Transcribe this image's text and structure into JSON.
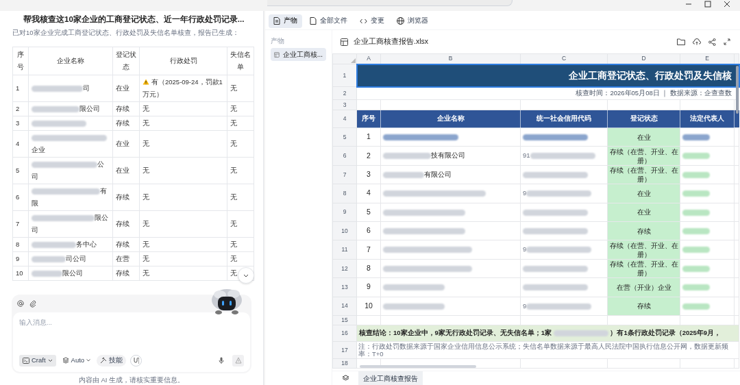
{
  "chat": {
    "title": "帮我核查这10家企业的工商登记状态、近一年行政处罚记录...",
    "intro": "已对10家企业完成工商登记状态、行政处罚及失信名单核查，报告已生成：",
    "table": {
      "columns": [
        "序号",
        "企业名称",
        "登记状态",
        "行政处罚",
        "失信名单"
      ],
      "rows": [
        {
          "index": "1",
          "name_blurred": true,
          "name": "司",
          "status": "在业",
          "warning": true,
          "penalty": "有（2025-09-24，罚款1万元）",
          "dishonest": "无"
        },
        {
          "index": "2",
          "name_blurred": true,
          "name": "限公司",
          "status": "存续",
          "warning": false,
          "penalty": "无",
          "dishonest": "无"
        },
        {
          "index": "3",
          "name_blurred": true,
          "status": "存续",
          "warning": false,
          "penalty": "无",
          "dishonest": "无"
        },
        {
          "index": "4",
          "name_blurred": true,
          "name": "企业",
          "status": "在业",
          "warning": false,
          "penalty": "无",
          "dishonest": "无"
        },
        {
          "index": "5",
          "name_blurred": true,
          "name": "公司",
          "status": "在业",
          "warning": false,
          "penalty": "无",
          "dishonest": "无"
        },
        {
          "index": "6",
          "name_blurred": true,
          "name": "有限",
          "status": "存续",
          "warning": false,
          "penalty": "无",
          "dishonest": "无"
        },
        {
          "index": "7",
          "name_blurred": true,
          "name": "限公司",
          "status": "存续",
          "warning": false,
          "penalty": "无",
          "dishonest": "无"
        },
        {
          "index": "8",
          "name_blurred": true,
          "name": "务中心",
          "status": "存续",
          "warning": false,
          "penalty": "无",
          "dishonest": "无"
        },
        {
          "index": "9",
          "name_blurred": true,
          "name": "司公司",
          "status": "在营",
          "warning": false,
          "penalty": "无",
          "dishonest": "无"
        },
        {
          "index": "10",
          "name_blurred": true,
          "name": "限公司",
          "status": "存续",
          "warning": false,
          "penalty": "无",
          "dishonest": "无"
        }
      ]
    },
    "composer": {
      "placeholder": "输入消息...",
      "mode": "Craft",
      "model": "Auto",
      "skill": "技能"
    },
    "disclaimer": "内容由 AI 生成，请核实重要信息。"
  },
  "panel": {
    "tabs": [
      {
        "label": "产物",
        "selected": true
      },
      {
        "label": "全部文件",
        "selected": false
      },
      {
        "label": "变更",
        "selected": false
      },
      {
        "label": "浏览器",
        "selected": false
      }
    ],
    "sidebar": {
      "heading": "产物",
      "items": [
        {
          "label": "企业工商核...",
          "selected": true
        }
      ]
    },
    "file": {
      "name": "企业工商核查报告.xlsx"
    },
    "sheet": {
      "columns": [
        "A",
        "B",
        "C",
        "D",
        "E"
      ],
      "row_numbers": [
        "1",
        "2",
        "3",
        "4",
        "5",
        "6",
        "7",
        "8",
        "9",
        "10",
        "11",
        "12",
        "13",
        "14",
        "15",
        "16",
        "17",
        "18"
      ],
      "title": "企业工商登记状态、行政处罚及失信核",
      "meta": "核查时间：2026年05月08日 ｜ 数据来源：企查查数",
      "headers": [
        "序号",
        "企业名称",
        "统一社会信用代码",
        "登记状态",
        "法定代表人"
      ],
      "rows": [
        {
          "index": "1",
          "name_blurred": true,
          "code_blurred": true,
          "status": "在业",
          "rep_blurred": true
        },
        {
          "index": "2",
          "name_blurred": true,
          "name": "技有限公司",
          "code": "91",
          "code_blurred": true,
          "status": "存续（在营、开业、在册）",
          "rep_blurred": true
        },
        {
          "index": "3",
          "name_blurred": true,
          "name": "有限公司",
          "code_blurred": true,
          "status": "存续（在营、开业、在册）",
          "rep_blurred": true
        },
        {
          "index": "4",
          "name_blurred": true,
          "code": "9",
          "code_blurred": true,
          "status": "在业",
          "rep_blurred": true
        },
        {
          "index": "5",
          "name_blurred": true,
          "code_blurred": true,
          "status": "在业",
          "rep_blurred": true
        },
        {
          "index": "6",
          "name_blurred": true,
          "code_blurred": true,
          "status": "存续",
          "rep_blurred": true
        },
        {
          "index": "7",
          "name_blurred": true,
          "code": "9",
          "code_blurred": true,
          "status": "存续（在营、开业、在册）",
          "rep_blurred": true
        },
        {
          "index": "8",
          "name_blurred": true,
          "code_blurred": true,
          "status": "存续（在营、开业、在册）",
          "rep_blurred": true
        },
        {
          "index": "9",
          "name_blurred": true,
          "code_blurred": true,
          "status": "在营（开业）企业",
          "rep_blurred": true
        },
        {
          "index": "10",
          "name_blurred": true,
          "code": "9",
          "code_blurred": true,
          "status": "存续",
          "rep_blurred": true
        }
      ],
      "conclusion_lead": "核查结论：10家企业中，9家无行政处罚记录、无失信名单；1家",
      "conclusion_blurred": true,
      "conclusion_tail": "）有1条行政处罚记录（2025年9月，",
      "note": "注：行政处罚数据来源于国家企业信用信息公示系统；失信名单数据来源于最高人民法院中国执行信息公开网，数据更新频率：T+0",
      "tabs": [
        {
          "label": "企业工商核查报告",
          "selected": true
        }
      ]
    }
  }
}
